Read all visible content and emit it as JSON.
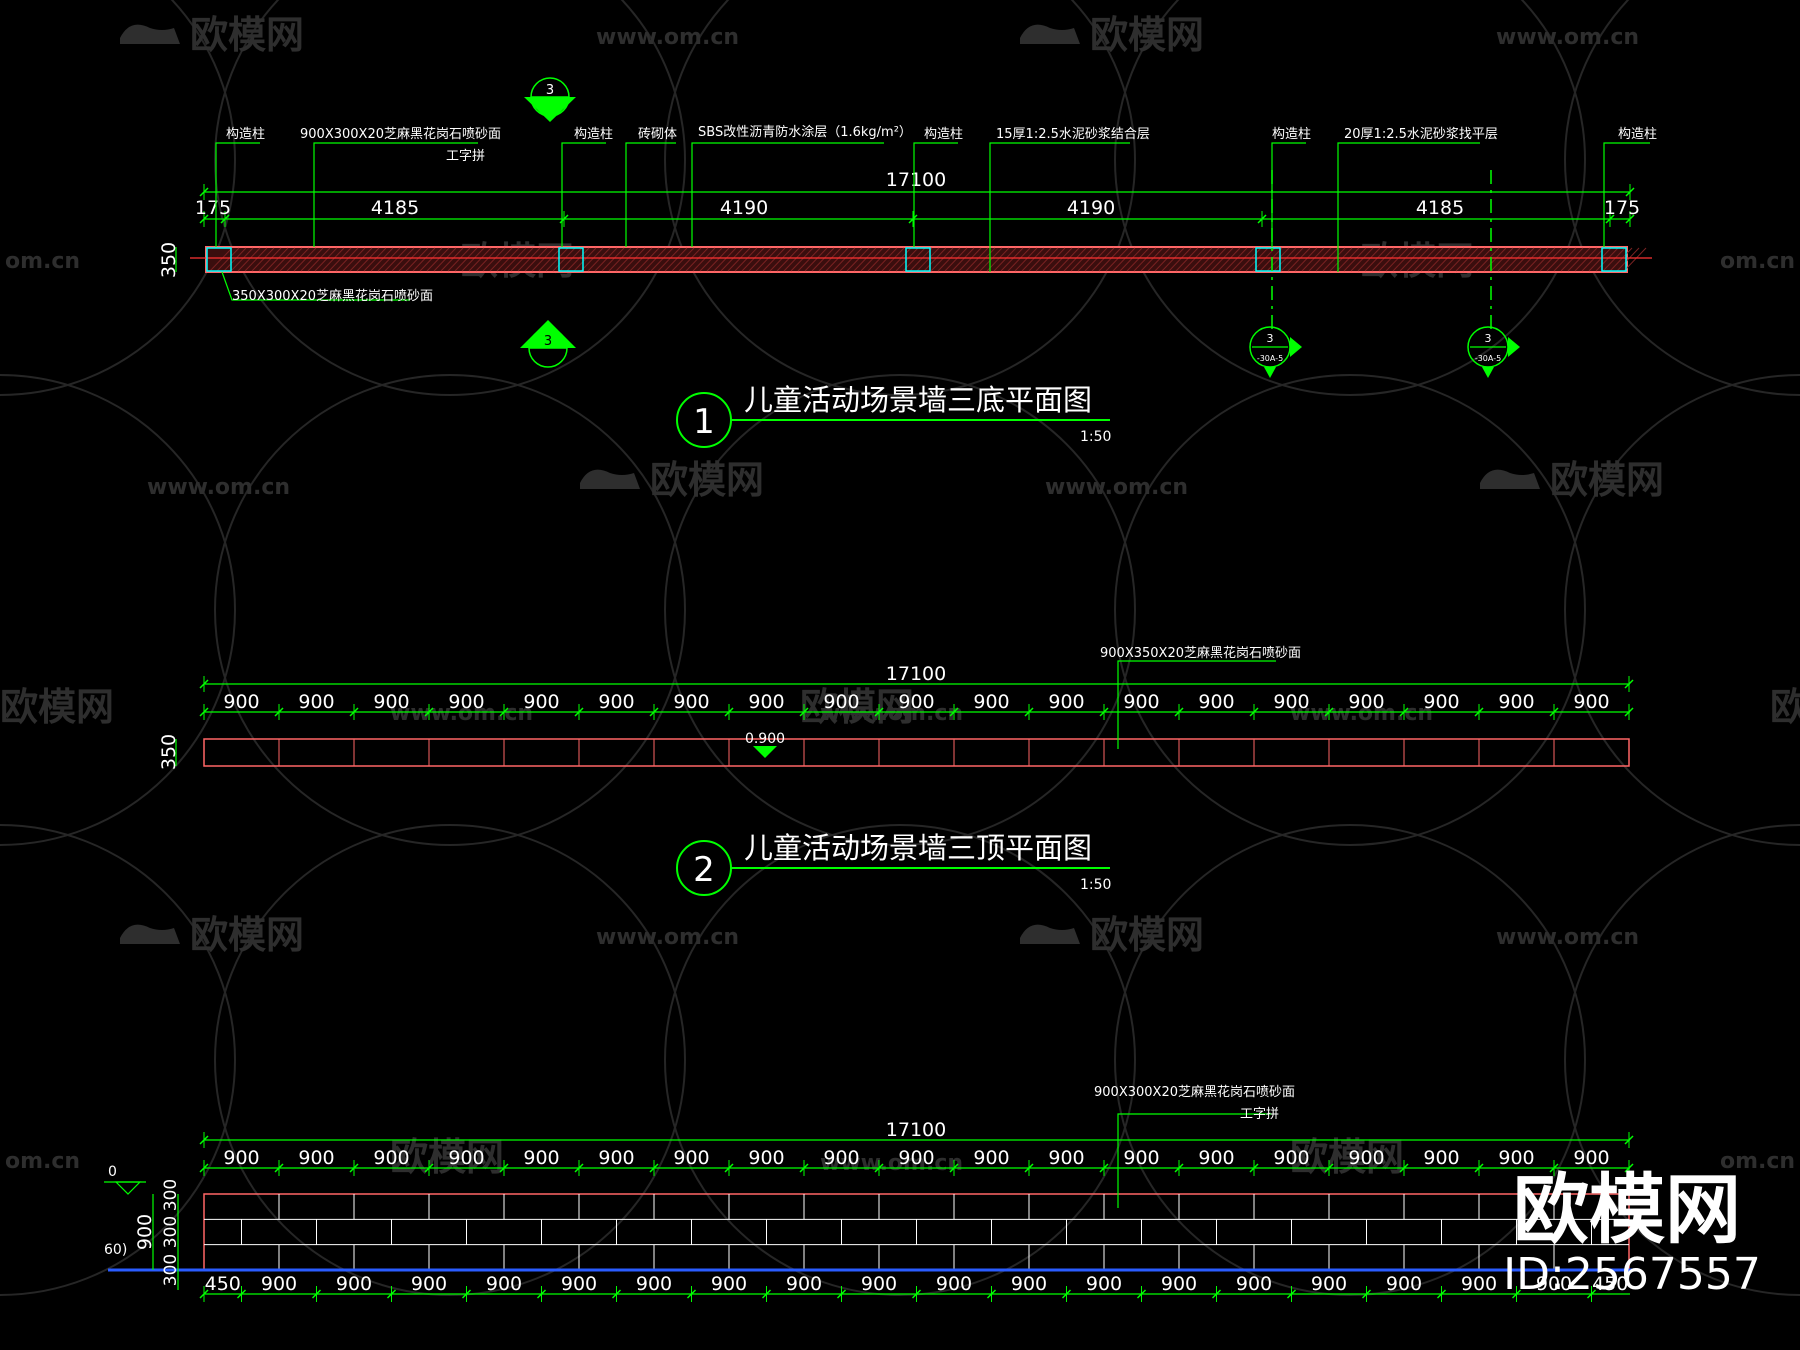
{
  "watermark": {
    "brand": "欧模网",
    "url": "www.om.cn",
    "url_short": "om.cn",
    "brand_partial": "欧模网",
    "brand_partial_right": "欧模"
  },
  "brand_badge": {
    "name": "欧模网",
    "id": "ID:2567557"
  },
  "colors": {
    "background": "#000000",
    "dim_line": "#00ff00",
    "outline": "#ff6666",
    "grid": "#ffffff",
    "column": "#00ffff",
    "hatch": "#8a2a2a",
    "level_line": "#2a5cff",
    "text": "#ffffff"
  },
  "plan1": {
    "title": "儿童活动场景墙三底平面图",
    "number": "1",
    "scale": "1:50",
    "total_dim": "17100",
    "dims": [
      "175",
      "4185",
      "4190",
      "4190",
      "4185",
      "175"
    ],
    "height_dim": "350",
    "section_mark": "3",
    "section_sub": "-30A-5",
    "labels": {
      "column_1": "构造柱",
      "stone_face": "900X300X20芝麻黑花岗石喷砂面",
      "i_joint": "工字拼",
      "column_2": "构造柱",
      "brick": "砖砌体",
      "sbs": "SBS改性沥青防水涂层（1.6kg/m²）",
      "column_3": "构造柱",
      "mortar_15": "15厚1:2.5水泥砂浆结合层",
      "column_4": "构造柱",
      "mortar_20": "20厚1:2.5水泥砂浆找平层",
      "column_5": "构造柱",
      "end_stone": "350X300X20芝麻黑花岗石喷砂面"
    }
  },
  "plan2": {
    "title": "儿童活动场景墙三顶平面图",
    "number": "2",
    "scale": "1:50",
    "total_dim": "17100",
    "module": "900",
    "module_count": 19,
    "height_dim": "350",
    "level": "0.900",
    "label": "900X350X20芝麻黑花岗石喷砂面"
  },
  "elevation": {
    "total_dim": "17100",
    "module": "900",
    "module_count": 19,
    "bottom_first": "450",
    "bottom_module": "900",
    "bottom_count": 18,
    "bottom_last": "450",
    "height_total": "900",
    "row_dims": [
      "300",
      "300",
      "300"
    ],
    "label": "900X300X20芝麻黑花岗石喷砂面",
    "label_2": "工字拼",
    "left_fragment_1": "0",
    "left_fragment_2": "60)"
  }
}
